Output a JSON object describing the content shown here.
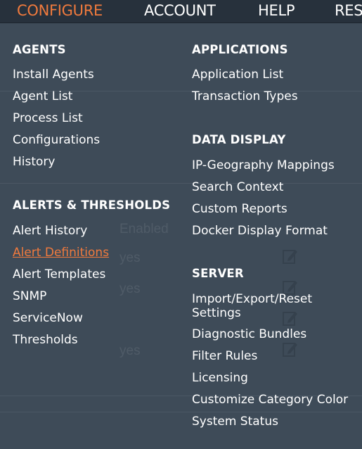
{
  "topnav": {
    "items": [
      "CONFIGURE",
      "ACCOUNT",
      "HELP",
      "RES"
    ],
    "active": "CONFIGURE",
    "active_color": "#f07a3d"
  },
  "background_page": {
    "column_header": "Enabled",
    "cells": [
      "yes",
      "yes",
      "yes"
    ],
    "row_icon": "edit-icon"
  },
  "menu": {
    "left": {
      "sections": [
        {
          "title": "AGENTS",
          "items": [
            "Install Agents",
            "Agent List",
            "Process List",
            "Configurations",
            "History"
          ]
        },
        {
          "title": "ALERTS & THRESHOLDS",
          "items": [
            "Alert History",
            "Alert Definitions",
            "Alert Templates",
            "SNMP",
            "ServiceNow",
            "Thresholds"
          ]
        }
      ]
    },
    "right": {
      "sections": [
        {
          "title": "APPLICATIONS",
          "items": [
            "Application List",
            "Transaction Types"
          ]
        },
        {
          "title": "DATA DISPLAY",
          "items": [
            "IP-Geography Mappings",
            "Search Context",
            "Custom Reports",
            "Docker Display Format"
          ]
        },
        {
          "title": "SERVER",
          "items": [
            "Import/Export/Reset Settings",
            "Diagnostic Bundles",
            "Filter Rules",
            "Licensing",
            "Customize Category Color",
            "System Status"
          ]
        }
      ]
    },
    "highlighted_item": "Alert Definitions",
    "highlight_color": "#f07a3d"
  }
}
